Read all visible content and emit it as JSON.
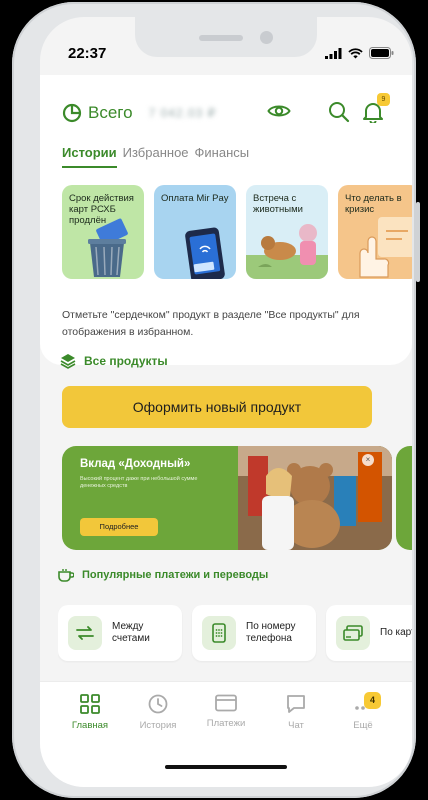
{
  "status": {
    "time": "22:37"
  },
  "header": {
    "title": "Всего",
    "balance": "7 042.03 ₽",
    "bell_badge": "9"
  },
  "tabs": [
    {
      "label": "Истории"
    },
    {
      "label": "Избранное"
    },
    {
      "label": "Финансы"
    }
  ],
  "stories": [
    {
      "text": "Срок действия карт РСХБ продлён",
      "color": "#bfe6a6"
    },
    {
      "text": "Оплата Mir Pay",
      "color": "#a8d4f0"
    },
    {
      "text": "Встреча с животными",
      "color": "#d9eef6"
    },
    {
      "text": "Что делать в кризис",
      "color": "#f5c58a"
    }
  ],
  "favorites_hint": "Отметьте \"сердечком\" продукт в разделе \"Все продукты\" для отображения в избранном.",
  "all_products_label": "Все продукты",
  "new_product_button": "Оформить новый продукт",
  "banner": {
    "title": "Вклад «Доходный»",
    "subtitle": "Высокий процент даже при небольшой сумме денежных средств",
    "button": "Подробнее"
  },
  "popular_label": "Популярные платежи и переводы",
  "quick_actions": [
    {
      "label": "Между счетами",
      "icon": "transfer-arrows-icon"
    },
    {
      "label": "По номеру телефона",
      "icon": "phone-icon"
    },
    {
      "label": "По карте",
      "icon": "card-icon"
    }
  ],
  "navbar": {
    "items": [
      {
        "label": "Главная",
        "icon": "grid-icon"
      },
      {
        "label": "История",
        "icon": "clock-icon"
      },
      {
        "label": "Платежи",
        "icon": "card-icon"
      },
      {
        "label": "Чат",
        "icon": "chat-icon"
      },
      {
        "label": "Ещё",
        "icon": "more-icon"
      }
    ],
    "more_badge": "4"
  },
  "colors": {
    "accent": "#3b8a2a",
    "yellow": "#f2c73a",
    "banner": "#6da63a"
  }
}
